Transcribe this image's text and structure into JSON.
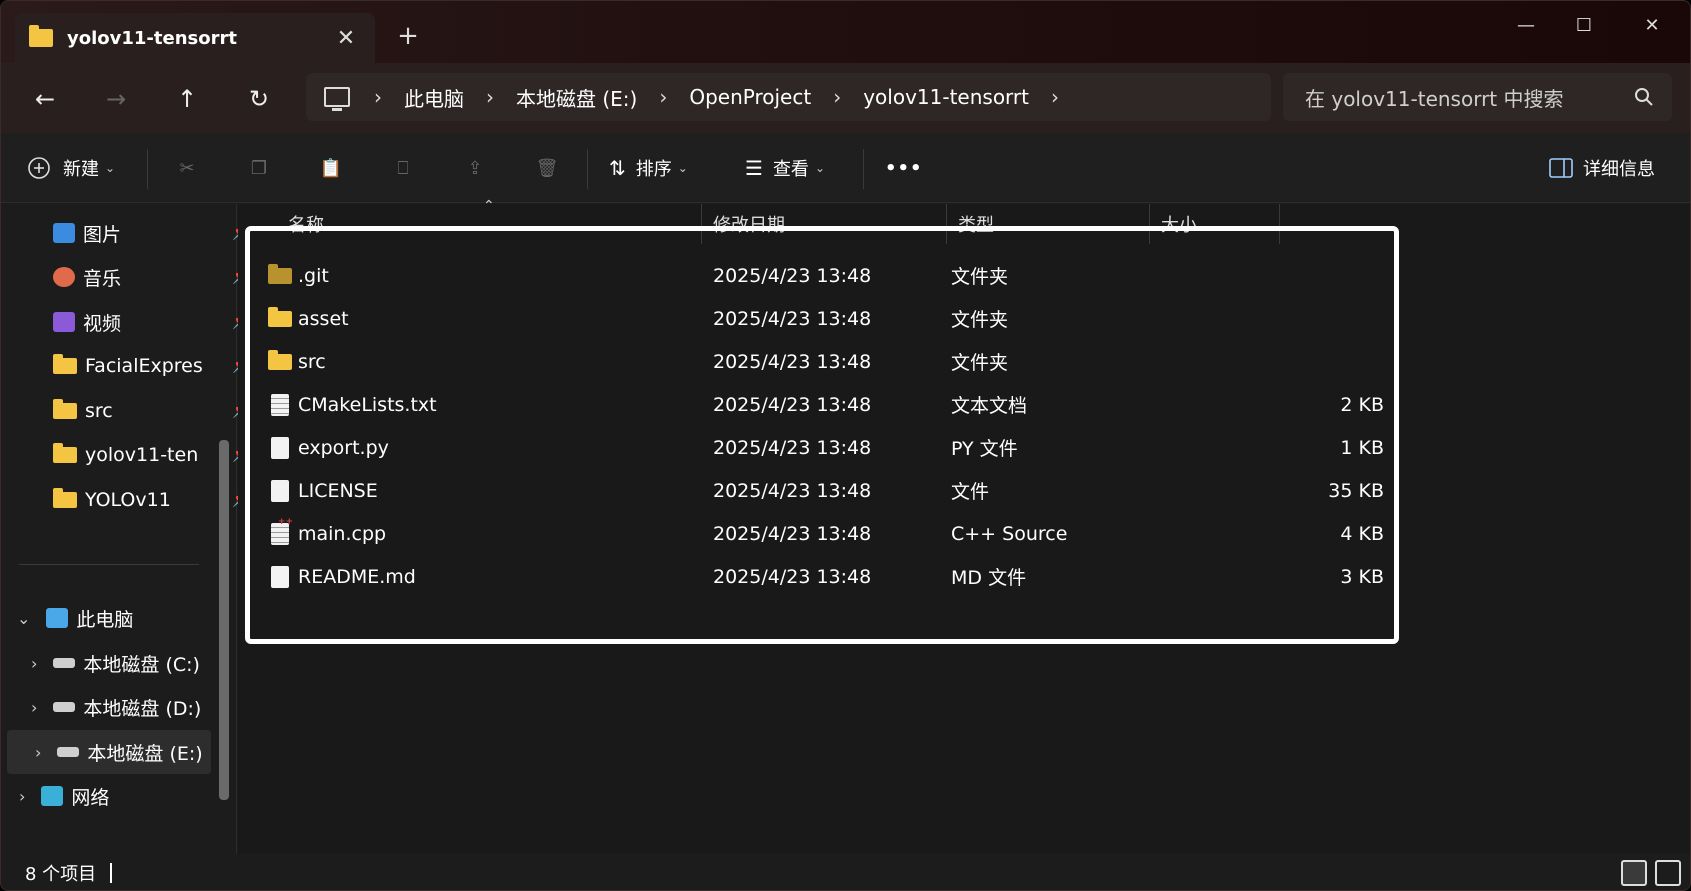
{
  "tab": {
    "title": "yolov11-tensorrt",
    "close": "✕"
  },
  "newtab": "+",
  "window_controls": {
    "minimize": "—",
    "maximize": "☐",
    "close": "✕"
  },
  "nav": {
    "back": "←",
    "forward": "→",
    "up": "↑",
    "refresh": "↻"
  },
  "breadcrumbs": [
    "此电脑",
    "本地磁盘 (E:)",
    "OpenProject",
    "yolov11-tensorrt"
  ],
  "search": {
    "placeholder": "在 yolov11-tensorrt 中搜索"
  },
  "toolbar": {
    "new_label": "新建",
    "sort_label": "排序",
    "view_label": "查看",
    "more_label": "•••",
    "details_label": "详细信息"
  },
  "sidebar": {
    "pinned": [
      {
        "label": "图片",
        "icon": "pictures-icon",
        "color": "#3b8be0"
      },
      {
        "label": "音乐",
        "icon": "music-icon",
        "color": "#e06a4a"
      },
      {
        "label": "视频",
        "icon": "videos-icon",
        "color": "#8a5ad8"
      },
      {
        "label": "FacialExpres",
        "icon": "folder-icon",
        "color": "#f4c542"
      },
      {
        "label": "src",
        "icon": "folder-icon",
        "color": "#f4c542"
      },
      {
        "label": "yolov11-ten",
        "icon": "folder-icon",
        "color": "#f4c542"
      },
      {
        "label": "YOLOv11",
        "icon": "folder-icon",
        "color": "#f4c542"
      }
    ],
    "this_pc": "此电脑",
    "drives": [
      "本地磁盘 (C:)",
      "本地磁盘 (D:)",
      "本地磁盘 (E:)"
    ],
    "network": "网络"
  },
  "columns": {
    "name": "名称",
    "date": "修改日期",
    "type": "类型",
    "size": "大小"
  },
  "files": [
    {
      "name": ".git",
      "date": "2025/4/23 13:48",
      "type": "文件夹",
      "size": "",
      "kind": "folder-dim"
    },
    {
      "name": "asset",
      "date": "2025/4/23 13:48",
      "type": "文件夹",
      "size": "",
      "kind": "folder"
    },
    {
      "name": "src",
      "date": "2025/4/23 13:48",
      "type": "文件夹",
      "size": "",
      "kind": "folder"
    },
    {
      "name": "CMakeLists.txt",
      "date": "2025/4/23 13:48",
      "type": "文本文档",
      "size": "2 KB",
      "kind": "text"
    },
    {
      "name": "export.py",
      "date": "2025/4/23 13:48",
      "type": "PY 文件",
      "size": "1 KB",
      "kind": "file"
    },
    {
      "name": "LICENSE",
      "date": "2025/4/23 13:48",
      "type": "文件",
      "size": "35 KB",
      "kind": "file"
    },
    {
      "name": "main.cpp",
      "date": "2025/4/23 13:48",
      "type": "C++ Source",
      "size": "4 KB",
      "kind": "cpp"
    },
    {
      "name": "README.md",
      "date": "2025/4/23 13:48",
      "type": "MD 文件",
      "size": "3 KB",
      "kind": "file"
    }
  ],
  "status": {
    "count": "8 个项目"
  }
}
